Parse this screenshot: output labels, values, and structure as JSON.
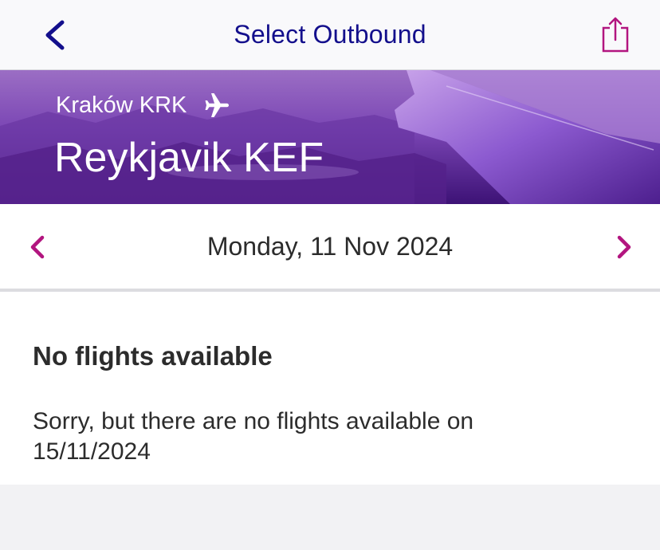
{
  "header": {
    "title": "Select Outbound",
    "back_icon": "chevron-left-icon",
    "share_icon": "share-icon",
    "title_color": "#130f8c"
  },
  "route": {
    "origin": "Kraków KRK",
    "destination": "Reykjavik KEF",
    "plane_icon": "airplane-icon"
  },
  "date_selector": {
    "date": "Monday, 11 Nov 2024",
    "prev_icon": "chevron-left-icon",
    "next_icon": "chevron-right-icon",
    "arrow_color": "#b2157f"
  },
  "results": {
    "title": "No flights available",
    "message": "Sorry, but there are no flights available on 15/11/2024"
  }
}
